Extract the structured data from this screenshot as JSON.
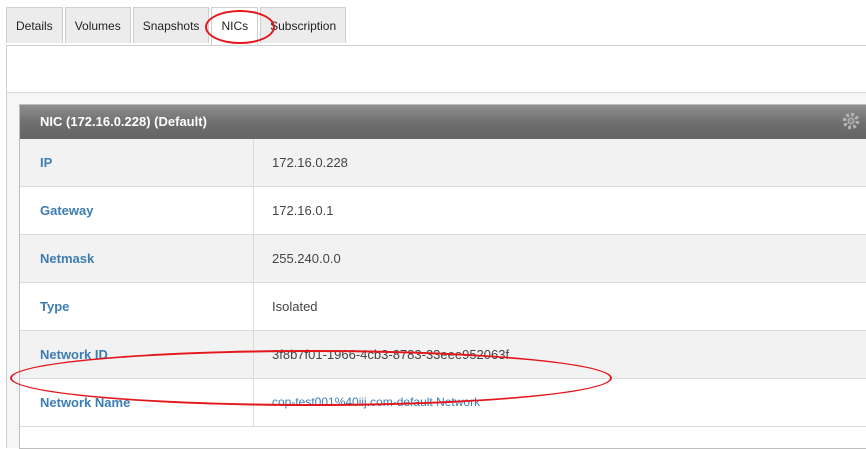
{
  "tabs": [
    {
      "label": "Details",
      "active": false
    },
    {
      "label": "Volumes",
      "active": false
    },
    {
      "label": "Snapshots",
      "active": false
    },
    {
      "label": "NICs",
      "active": true
    },
    {
      "label": "Subscription",
      "active": false
    }
  ],
  "panel": {
    "title": "NIC (172.16.0.228) (Default)",
    "rows": [
      {
        "label": "IP",
        "value": "172.16.0.228"
      },
      {
        "label": "Gateway",
        "value": "172.16.0.1"
      },
      {
        "label": "Netmask",
        "value": "255.240.0.0"
      },
      {
        "label": "Type",
        "value": "Isolated"
      },
      {
        "label": "Network ID",
        "value": "3f8b7f01-1966-4cb3-8783-33eee952063f"
      },
      {
        "label": "Network Name",
        "value": "cop-test001%40iij.com-default Network"
      }
    ]
  },
  "colors": {
    "annotation": "#e3161b",
    "label": "#3d7db4",
    "header": "#6e6e6e"
  }
}
